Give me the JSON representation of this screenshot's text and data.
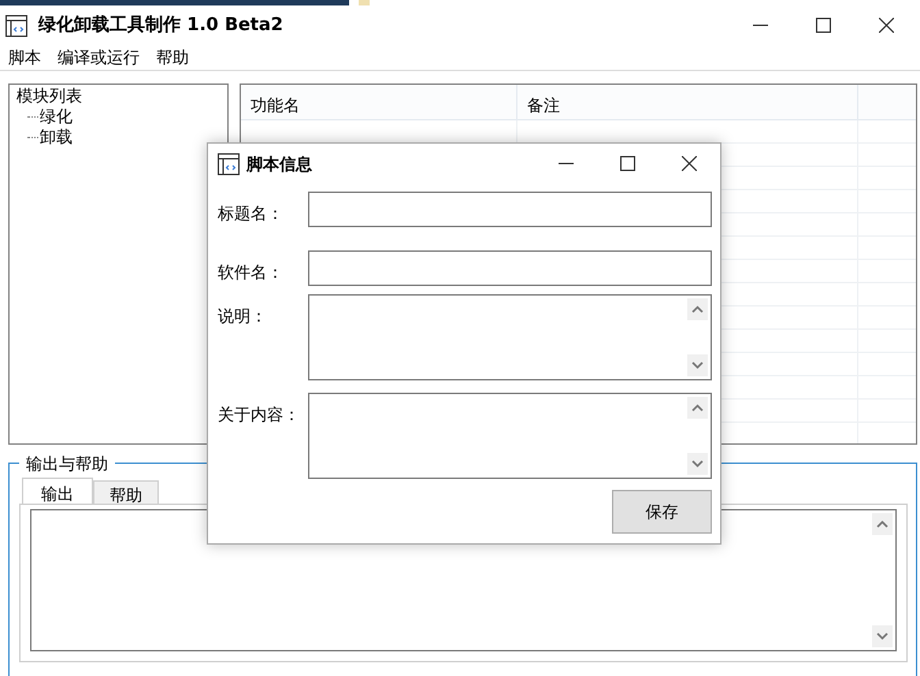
{
  "window": {
    "title": "绿化卸载工具制作 1.0 Beta2"
  },
  "menu": [
    "脚本",
    "编译或运行",
    "帮助"
  ],
  "tree": {
    "label": "模块列表",
    "children": [
      {
        "label": "绿化"
      },
      {
        "label": "卸载"
      }
    ]
  },
  "table": {
    "columns": [
      "功能名",
      "备注"
    ]
  },
  "output_group": {
    "title": "输出与帮助",
    "tabs": [
      {
        "label": "输出",
        "selected": true
      },
      {
        "label": "帮助",
        "selected": false
      }
    ]
  },
  "dialog": {
    "title": "脚本信息",
    "fields": [
      {
        "label": "标题名：",
        "kind": "line"
      },
      {
        "label": "软件名：",
        "kind": "line"
      },
      {
        "label": "说明：",
        "kind": "multiline"
      },
      {
        "label": "关于内容：",
        "kind": "multiline"
      }
    ],
    "button": "保存"
  }
}
